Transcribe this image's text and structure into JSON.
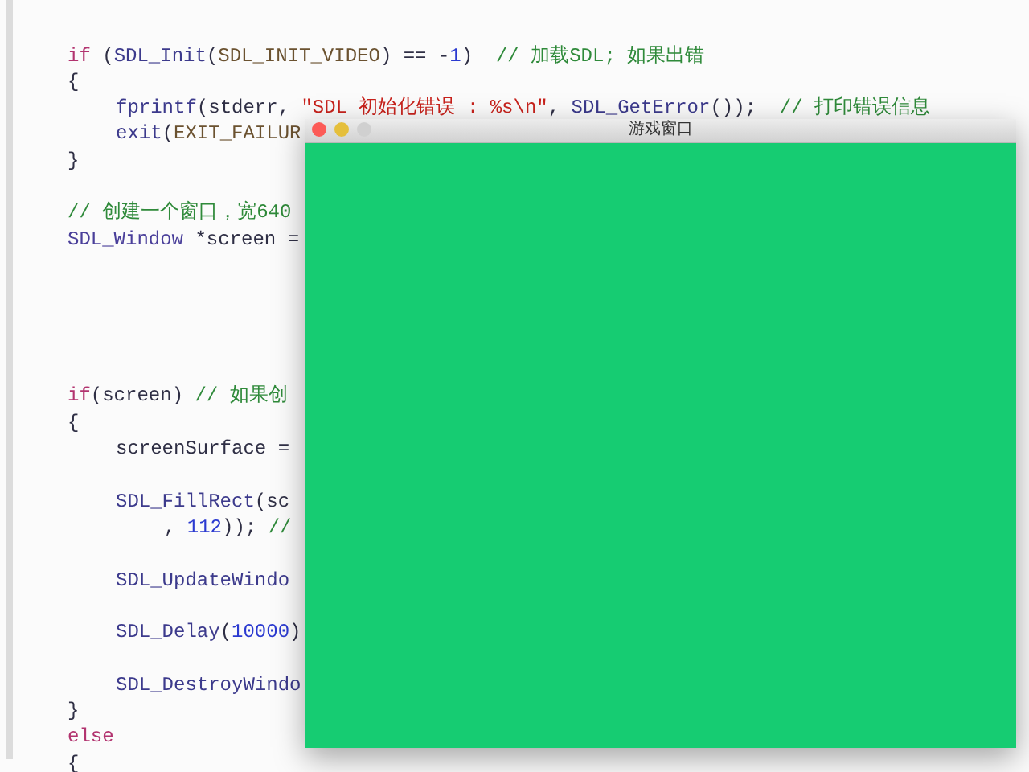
{
  "editor": {
    "lines": [
      {
        "kind": "blank"
      },
      {
        "kind": "blank"
      },
      {
        "kind": "top",
        "segments": [
          {
            "kind": "keyword",
            "text": "if"
          },
          {
            "kind": "plain",
            "text": " ("
          },
          {
            "kind": "func",
            "text": "SDL_Init"
          },
          {
            "kind": "plain",
            "text": "("
          },
          {
            "kind": "macro",
            "text": "SDL_INIT_VIDEO"
          },
          {
            "kind": "plain",
            "text": ") == -"
          },
          {
            "kind": "number",
            "text": "1"
          },
          {
            "kind": "plain",
            "text": ")  "
          },
          {
            "kind": "comment",
            "text": "// 加载SDL; 如果出错"
          }
        ]
      },
      {
        "kind": "top",
        "segments": [
          {
            "kind": "plain",
            "text": "{"
          }
        ]
      },
      {
        "kind": "inner",
        "segments": [
          {
            "kind": "func",
            "text": "fprintf"
          },
          {
            "kind": "plain",
            "text": "(stderr, "
          },
          {
            "kind": "string",
            "text": "\"SDL 初始化错误 : %s\\n\""
          },
          {
            "kind": "plain",
            "text": ", "
          },
          {
            "kind": "func",
            "text": "SDL_GetError"
          },
          {
            "kind": "plain",
            "text": "());  "
          },
          {
            "kind": "comment",
            "text": "// 打印错误信息"
          }
        ]
      },
      {
        "kind": "inner",
        "segments": [
          {
            "kind": "func",
            "text": "exit"
          },
          {
            "kind": "plain",
            "text": "("
          },
          {
            "kind": "macro",
            "text": "EXIT_FAILUR"
          }
        ]
      },
      {
        "kind": "top",
        "segments": [
          {
            "kind": "plain",
            "text": "}"
          }
        ]
      },
      {
        "kind": "blank"
      },
      {
        "kind": "top",
        "segments": [
          {
            "kind": "comment",
            "text": "// 创建一个窗口，宽640"
          }
        ]
      },
      {
        "kind": "top",
        "segments": [
          {
            "kind": "type",
            "text": "SDL_Window"
          },
          {
            "kind": "plain",
            "text": " *screen ="
          }
        ]
      },
      {
        "kind": "blank"
      },
      {
        "kind": "blank"
      },
      {
        "kind": "blank"
      },
      {
        "kind": "blank"
      },
      {
        "kind": "blank"
      },
      {
        "kind": "top",
        "segments": [
          {
            "kind": "keyword",
            "text": "if"
          },
          {
            "kind": "plain",
            "text": "(screen) "
          },
          {
            "kind": "comment",
            "text": "// 如果创"
          }
        ]
      },
      {
        "kind": "top",
        "segments": [
          {
            "kind": "plain",
            "text": "{"
          }
        ]
      },
      {
        "kind": "inner",
        "segments": [
          {
            "kind": "plain",
            "text": "screenSurface ="
          }
        ]
      },
      {
        "kind": "blank"
      },
      {
        "kind": "inner",
        "segments": [
          {
            "kind": "func",
            "text": "SDL_FillRect"
          },
          {
            "kind": "plain",
            "text": "(sc"
          }
        ]
      },
      {
        "kind": "wrapped",
        "segments": [
          {
            "kind": "plain",
            "text": ", "
          },
          {
            "kind": "number",
            "text": "112"
          },
          {
            "kind": "plain",
            "text": ")); "
          },
          {
            "kind": "comment",
            "text": "//"
          }
        ]
      },
      {
        "kind": "blank"
      },
      {
        "kind": "inner",
        "segments": [
          {
            "kind": "func",
            "text": "SDL_UpdateWindo"
          }
        ]
      },
      {
        "kind": "blank"
      },
      {
        "kind": "inner",
        "segments": [
          {
            "kind": "func",
            "text": "SDL_Delay"
          },
          {
            "kind": "plain",
            "text": "("
          },
          {
            "kind": "number",
            "text": "10000"
          },
          {
            "kind": "plain",
            "text": ")"
          }
        ]
      },
      {
        "kind": "blank"
      },
      {
        "kind": "inner",
        "segments": [
          {
            "kind": "func",
            "text": "SDL_DestroyWindo"
          }
        ]
      },
      {
        "kind": "top",
        "segments": [
          {
            "kind": "plain",
            "text": "}"
          }
        ]
      },
      {
        "kind": "top",
        "segments": [
          {
            "kind": "keyword",
            "text": "else"
          }
        ]
      },
      {
        "kind": "top",
        "segments": [
          {
            "kind": "plain",
            "text": "{"
          }
        ]
      }
    ]
  },
  "game_window": {
    "title": "游戏窗口"
  }
}
